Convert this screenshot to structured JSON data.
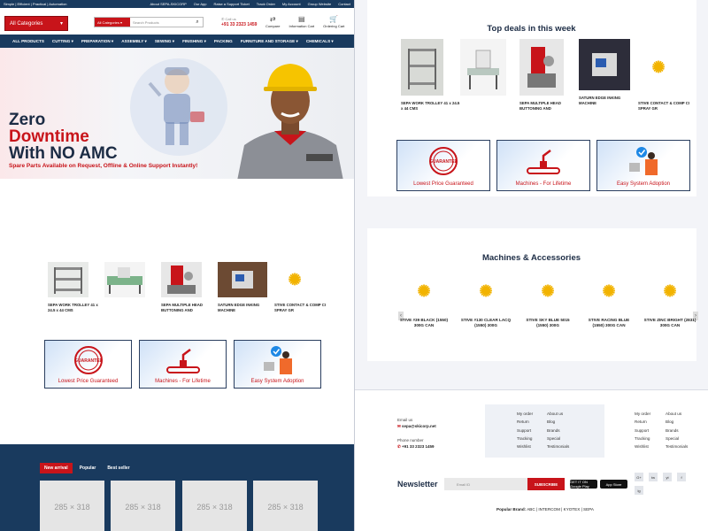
{
  "topbar": {
    "tagline": "Simple | Efficient | Practical | Automation",
    "links": [
      "About SEPA-SKICORP",
      "Our App",
      "Raise a Support Ticket",
      "Track Order",
      "My Account",
      "Group Website",
      "Contact"
    ]
  },
  "header": {
    "category_button": "All Categories",
    "search_select": "All Categories",
    "search_placeholder": "Search Products",
    "call_label": "Call us",
    "call_number": "+91 33 2323 1459",
    "icons": [
      {
        "label": "Compare",
        "icon": "compare-icon"
      },
      {
        "label": "Information Cart",
        "icon": "document-icon"
      },
      {
        "label": "Ordering Cart",
        "icon": "cart-icon"
      }
    ]
  },
  "nav": {
    "items": [
      "ALL PRODUCTS",
      "CUTTING ▾",
      "PREPARATION ▾",
      "ASSEMBLY ▾",
      "SEWING ▾",
      "FINISHING ▾",
      "PACKING",
      "FURNITURE AND STORAGE ▾",
      "CHEMICALS ▾"
    ]
  },
  "hero": {
    "line1": "Zero",
    "line2": "Downtime",
    "line3": "With NO AMC",
    "subtitle": "Spare Parts Available on Request, Offline & Online Support Instantly!"
  },
  "left_products": [
    {
      "name": "SEPA WORK TROLLEY 41 x 24.5 x 44 CMS"
    },
    {
      "name": ""
    },
    {
      "name": "SEPA MULTIPLE HEAD BUTTONING AND"
    },
    {
      "name": "SATURN EDGE INKING MACHINE"
    },
    {
      "name": "STIVE CONTACT & COMP CI SPRAY GR"
    }
  ],
  "features": [
    {
      "label": "Lowest Price Guaranteed",
      "badge": "GUARANTEE"
    },
    {
      "label": "Machines - For Lifetime"
    },
    {
      "label": "Easy System Adoption"
    }
  ],
  "tabs": [
    "New arrival",
    "Popular",
    "Best seller"
  ],
  "placeholders": [
    "285 × 318",
    "285 × 318",
    "285 × 318",
    "285 × 318"
  ],
  "deals": {
    "title": "Top deals in this week",
    "products": [
      {
        "name": "SEPA WORK TROLLEY 41 x 24.5 x 44 CMS"
      },
      {
        "name": ""
      },
      {
        "name": "SEPA MULTIPLE HEAD BUTTONING AND"
      },
      {
        "name": "SATURN EDGE INKING MACHINE"
      },
      {
        "name": "STIVE CONTACT & COMP CI SPRAY GR"
      }
    ]
  },
  "accessories": {
    "title": "Machines & Accessories",
    "items": [
      "STIVE #39 BLACK (1550) 300G CAN",
      "STIVE #130 CLEAR LACQ (1550) 300G",
      "STIVE SKY BLUE 5015 (1550) 300G",
      "STIVE RACING BLUE (1550) 300G CAN",
      "STIVE ZINC BRIGHT (2831) 300G CAN"
    ],
    "prev": "‹",
    "next": "›"
  },
  "footer": {
    "email_label": "Email us",
    "email": "sepa@skicorp.net",
    "phone_label": "Phone number",
    "phone": "+91 33 2323 1459",
    "links_col1": [
      "My order",
      "Return",
      "Support",
      "Tracking",
      "Wishlist"
    ],
    "links_col2": [
      "About us",
      "Blog",
      "Brands",
      "Special",
      "Testimonials"
    ],
    "newsletter": "Newsletter",
    "email_placeholder": "Email ID",
    "subscribe": "SUBSCRIBE",
    "google_play": "GET IT ON Google Play",
    "app_store": "App Store",
    "social": [
      "G+",
      "tw",
      "yt",
      "f",
      "ig"
    ],
    "brands_label": "Popular Brand:",
    "brands": "ABC | INTERCOM | KYOTEX | SEPA"
  },
  "colors": {
    "navy": "#193a5e",
    "red": "#c8141a",
    "gold": "#f2b300"
  }
}
